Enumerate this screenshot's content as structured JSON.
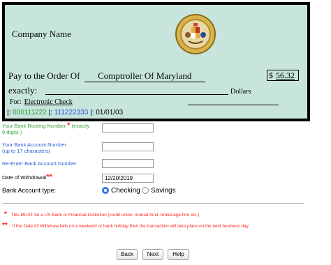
{
  "check": {
    "company_name": "Company Name",
    "pay_to_label": "Pay to the Order Of",
    "payee": "Comptroller Of Maryland",
    "amount_symbol": "$",
    "amount": "56.32",
    "exactly_label": "exactly:",
    "dollars_label": "Dollars",
    "for_label": "For:",
    "for_value": "Electronic Check",
    "micr": {
      "sep1": "|:",
      "routing": "000111222",
      "sep2": "|:",
      "account": "111222333",
      "sep3": "|:",
      "date": "01/01/03"
    }
  },
  "form": {
    "routing_label_line1": "Your Bank Routing Number",
    "routing_label_star": "*",
    "routing_label_tail": "(exactly",
    "routing_label_line2": "9 digits )",
    "routing_value": "",
    "account_label_line1": "Your Bank Account Number",
    "account_label_line2": "(up to 17 characters)",
    "account_value": "",
    "reenter_label": "Re-Enter Bank Account Number",
    "reenter_value": "",
    "withdrawal_label": "Date of Withdrawal",
    "withdrawal_star": "**",
    "withdrawal_value": "12/20/2019",
    "account_type_label": "Bank Account type:",
    "account_type_options": [
      "Checking",
      "Savings"
    ],
    "account_type_selected": "Checking"
  },
  "notes": {
    "note1_mark": "*",
    "note1_text": "This MUST be a US Bank or Financial Institution (credit union, mutual fund, brokerage firm etc.)",
    "note2_mark": "**",
    "note2_text": "If the Date Of Withdraw falls on a weekend or bank holiday then the transaction will take place on the next business day"
  },
  "buttons": {
    "back": "Back",
    "next": "Next",
    "help": "Help"
  },
  "colors": {
    "check_bg": "#c7e4dd",
    "required": "#ff2020",
    "link_blue": "#2b5fd9",
    "green": "#3aa23a"
  },
  "icons": [
    "maryland-seal-icon",
    "radio-selected-icon",
    "radio-unselected-icon"
  ]
}
